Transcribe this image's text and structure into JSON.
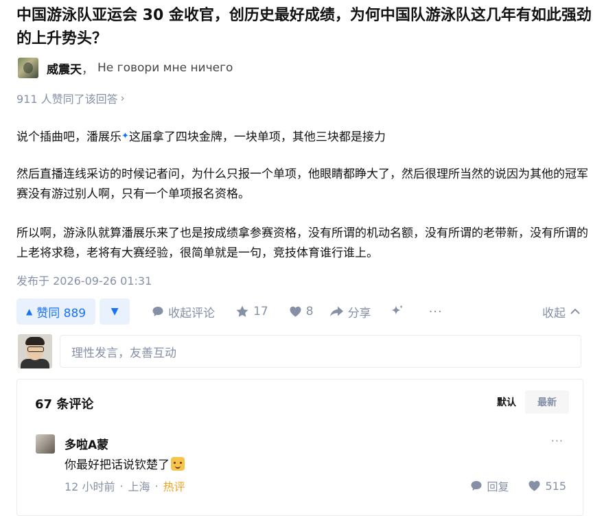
{
  "question": {
    "title": "中国游泳队亚运会 30 金收官，创历史最好成绩，为何中国队游泳队这几年有如此强劲的上升势头？"
  },
  "author": {
    "name": "威震天",
    "separator": "，",
    "bio": "Не говори мне ничего"
  },
  "answer": {
    "votes_summary": "911 人赞同了该回答",
    "paragraphs": {
      "p1a": "说个插曲吧，潘展乐",
      "p1b": "这届拿了四块金牌，一块单项，其他三块都是接力",
      "p2": "然后直播连线采访的时候记者问，为什么只报一个单项，他眼睛都睁大了，然后很理所当然的说因为其他的冠军赛没有游过别人啊，只有一个单项报名资格。",
      "p3": "所以啊，游泳队就算潘展乐来了也是按成绩拿参赛资格，没有所谓的机动名额，没有所谓的老带新，没有所谓的上老将求稳，老将有大赛经验，很简单就是一句，竞技体育谁行谁上。"
    },
    "published": "发布于 2026-09-26 01:31"
  },
  "actions": {
    "upvote_label": "赞同 889",
    "collapse_comments": "收起评论",
    "favorites": "17",
    "likes": "8",
    "share": "分享",
    "more": "···",
    "collapse": "收起"
  },
  "comment_box": {
    "placeholder": "理性发言，友善互动"
  },
  "comments": {
    "count_label": "67 条评论",
    "sort_default": "默认",
    "sort_newest": "最新",
    "items": [
      {
        "user": "多啦A蒙",
        "text": "你最好把话说钦楚了",
        "time": "12 小时前",
        "location": "上海",
        "tag": "热评",
        "reply": "回复",
        "likes": "515",
        "more": "···"
      }
    ]
  },
  "colors": {
    "accent": "#1772f6",
    "accent_bg": "#e9f1fd",
    "muted": "#8590a6",
    "hot_tag": "#f0a020"
  }
}
